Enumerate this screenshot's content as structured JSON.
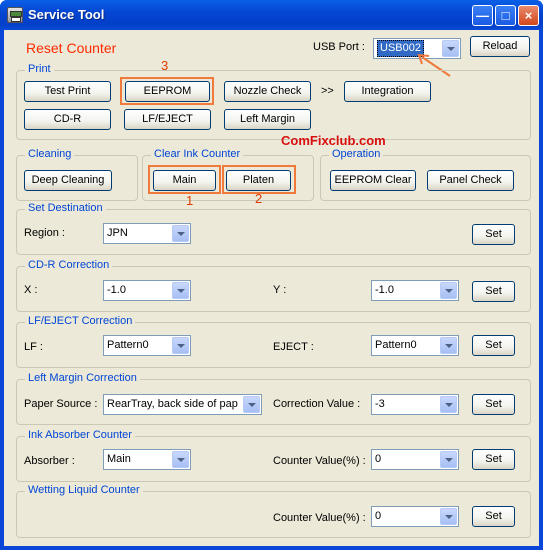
{
  "window": {
    "title": "Service Tool"
  },
  "header": {
    "heading": "Reset Counter",
    "usb_label": "USB Port :",
    "usb_value": "USB002",
    "reload": "Reload"
  },
  "print": {
    "label": "Print",
    "test_print": "Test Print",
    "eeprom": "EEPROM",
    "nozzle_check": "Nozzle Check",
    "chevrons": ">>",
    "integration": "Integration",
    "cdr": "CD-R",
    "lf_eject": "LF/EJECT",
    "left_margin": "Left Margin"
  },
  "watermark": "ComFixclub.com",
  "cleaning": {
    "label": "Cleaning",
    "deep": "Deep Cleaning"
  },
  "clear_ink": {
    "label": "Clear Ink Counter",
    "main": "Main",
    "platen": "Platen"
  },
  "operation": {
    "label": "Operation",
    "eeprom_clear": "EEPROM Clear",
    "panel_check": "Panel Check"
  },
  "annotations": {
    "n1": "1",
    "n2": "2",
    "n3": "3"
  },
  "set_destination": {
    "label": "Set Destination",
    "region_label": "Region :",
    "region_value": "JPN",
    "set": "Set"
  },
  "cdr_correction": {
    "label": "CD-R Correction",
    "x_label": "X :",
    "x_value": "-1.0",
    "y_label": "Y :",
    "y_value": "-1.0",
    "set": "Set"
  },
  "lf_correction": {
    "label": "LF/EJECT Correction",
    "lf_label": "LF :",
    "lf_value": "Pattern0",
    "eject_label": "EJECT :",
    "eject_value": "Pattern0",
    "set": "Set"
  },
  "left_margin_correction": {
    "label": "Left Margin Correction",
    "paper_label": "Paper Source :",
    "paper_value": "RearTray, back side of pap",
    "corr_label": "Correction Value :",
    "corr_value": "-3",
    "set": "Set"
  },
  "ink_absorber": {
    "label": "Ink Absorber Counter",
    "absorber_label": "Absorber :",
    "absorber_value": "Main",
    "counter_label": "Counter Value(%) :",
    "counter_value": "0",
    "set": "Set"
  },
  "wetting": {
    "label": "Wetting Liquid Counter",
    "counter_label": "Counter Value(%) :",
    "counter_value": "0",
    "set": "Set"
  },
  "colors": {
    "highlight": "#f07a3c",
    "annotation": "#e03a00",
    "group_label": "#0046d5",
    "heading": "#ff2a00"
  }
}
